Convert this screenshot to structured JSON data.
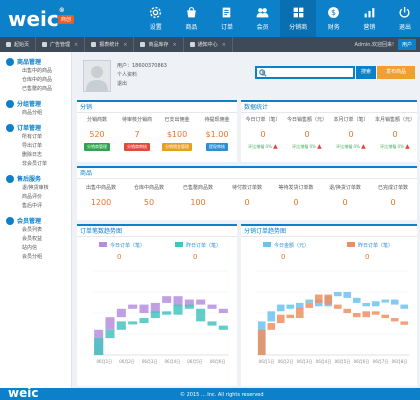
{
  "brand": {
    "logo": "weic",
    "logo_reg": "®",
    "tag": "商创"
  },
  "topnav": [
    {
      "label": "设置",
      "icon": "gear-icon"
    },
    {
      "label": "商品",
      "icon": "goods-icon"
    },
    {
      "label": "订单",
      "icon": "order-icon"
    },
    {
      "label": "会员",
      "icon": "members-icon"
    },
    {
      "label": "分销商",
      "icon": "distributor-icon"
    },
    {
      "label": "财务",
      "icon": "finance-icon"
    },
    {
      "label": "营销",
      "icon": "marketing-icon"
    },
    {
      "label": "退出",
      "icon": "logout-icon"
    }
  ],
  "subtabs": [
    {
      "label": "起始页"
    },
    {
      "label": "广告管理"
    },
    {
      "label": "报表统计"
    },
    {
      "label": "商品库存"
    },
    {
      "label": "通知中心"
    }
  ],
  "subbar_right": {
    "welcome": "Admin,欢迎回来!",
    "user_btn": "用户"
  },
  "sidebar": [
    {
      "title": "商品管理",
      "items": [
        "出售中的商品",
        "仓库中的商品",
        "已售罄的商品"
      ]
    },
    {
      "title": "分组管理",
      "items": [
        "商品分组"
      ]
    },
    {
      "title": "订单管理",
      "items": [
        "所有订单",
        "导出订单",
        "删除日志",
        "非会员订单"
      ]
    },
    {
      "title": "售后服务",
      "items": [
        "退/换货审核",
        "商品评价",
        "售后中评"
      ]
    },
    {
      "title": "会员管理",
      "items": [
        "会员列表",
        "会员权益",
        "站内信",
        "会员分组"
      ]
    }
  ],
  "user": {
    "line1": "用户：18600370863",
    "line2": "个人资料",
    "line3": "退出"
  },
  "search": {
    "placeholder": "",
    "button": "搜索",
    "mall_button": "发布商品"
  },
  "distribution": {
    "title": "分销",
    "stats": [
      {
        "label": "分销商数",
        "value": "520",
        "tag": "分销商管理",
        "color": "#2ea44f"
      },
      {
        "label": "待审核分销商",
        "value": "7",
        "tag": "分销商审核",
        "color": "#e04a3a"
      },
      {
        "label": "已支出佣金",
        "value": "$100",
        "tag": "分销佣金管理",
        "color": "#e6a01c"
      },
      {
        "label": "待提现佣金",
        "value": "$1.00",
        "tag": "提现审核",
        "color": "#2b8fd8"
      }
    ]
  },
  "data_stats": {
    "title": "数据统计",
    "stats": [
      {
        "label": "今日订单（笔）",
        "value": "0",
        "trend": "环比增幅 0%"
      },
      {
        "label": "今日销售额（元）",
        "value": "0",
        "trend": "环比增幅 0%"
      },
      {
        "label": "本月订单（笔）",
        "value": "0",
        "trend": "环比增幅 0%"
      },
      {
        "label": "本月销售额（元）",
        "value": "0",
        "trend": "环比增幅 0%"
      }
    ]
  },
  "goods": {
    "title": "商品",
    "stats": [
      {
        "label": "出售中商品数",
        "value": "1200"
      },
      {
        "label": "仓库中商品数",
        "value": "50"
      },
      {
        "label": "已售罄商品数",
        "value": "100"
      },
      {
        "label": "待付款订单数",
        "value": "0"
      },
      {
        "label": "等待发货订单数",
        "value": "0"
      },
      {
        "label": "退/换货订单数",
        "value": "0"
      },
      {
        "label": "已完成订单数",
        "value": "0"
      }
    ]
  },
  "orders_chart": {
    "title": "订单笔数趋势图",
    "legend": [
      {
        "label": "今日订单（笔）",
        "value": "0",
        "color": "#b58ee0"
      },
      {
        "label": "昨日订单（笔）",
        "value": "0",
        "color": "#44c4c0"
      }
    ]
  },
  "sales_chart": {
    "title": "分销订单趋势图",
    "legend": [
      {
        "label": "今日金额（元）",
        "value": "0",
        "color": "#6cc2ef"
      },
      {
        "label": "昨日订单（笔）",
        "value": "0",
        "color": "#ef8f5f"
      }
    ]
  },
  "chart_data": [
    {
      "type": "bar",
      "title": "订单笔数趋势图",
      "categories": [
        "1",
        "2",
        "3",
        "4",
        "5",
        "6",
        "7",
        "8",
        "9",
        "10",
        "11",
        "12"
      ],
      "series": [
        {
          "name": "今日订单（笔）",
          "values": [
            30,
            45,
            55,
            60,
            50,
            62,
            70,
            58,
            66,
            60,
            55,
            50
          ]
        },
        {
          "name": "昨日订单（笔）",
          "values": [
            20,
            30,
            40,
            38,
            44,
            52,
            48,
            60,
            55,
            40,
            35,
            30
          ]
        }
      ],
      "x_tick_labels": [
        "06月1日",
        "06月2日",
        "06月3日",
        "06月4日",
        "06月5日",
        "06月6日"
      ],
      "ylim": [
        0,
        100
      ]
    },
    {
      "type": "bar",
      "title": "分销订单趋势图",
      "categories": [
        "1",
        "2",
        "3",
        "4",
        "5",
        "6",
        "7",
        "8",
        "9",
        "10",
        "11",
        "12",
        "13",
        "14",
        "15",
        "16"
      ],
      "series": [
        {
          "name": "今日金额（元）",
          "values": [
            40,
            52,
            60,
            55,
            62,
            66,
            58,
            70,
            75,
            68,
            62,
            58,
            64,
            66,
            60,
            55
          ]
        },
        {
          "name": "昨日订单（笔）",
          "values": [
            30,
            38,
            48,
            44,
            56,
            62,
            72,
            60,
            55,
            50,
            45,
            52,
            48,
            44,
            40,
            36
          ]
        }
      ],
      "x_tick_labels": [
        "06月1日",
        "06月2日",
        "06月3日",
        "06月4日",
        "06月5日",
        "06月6日",
        "06月7日",
        "06月8日"
      ],
      "ylim": [
        0,
        100
      ]
    }
  ],
  "footer": {
    "logo": "weic",
    "copyright": "© 2015 ... Inc. All rights reserved"
  }
}
